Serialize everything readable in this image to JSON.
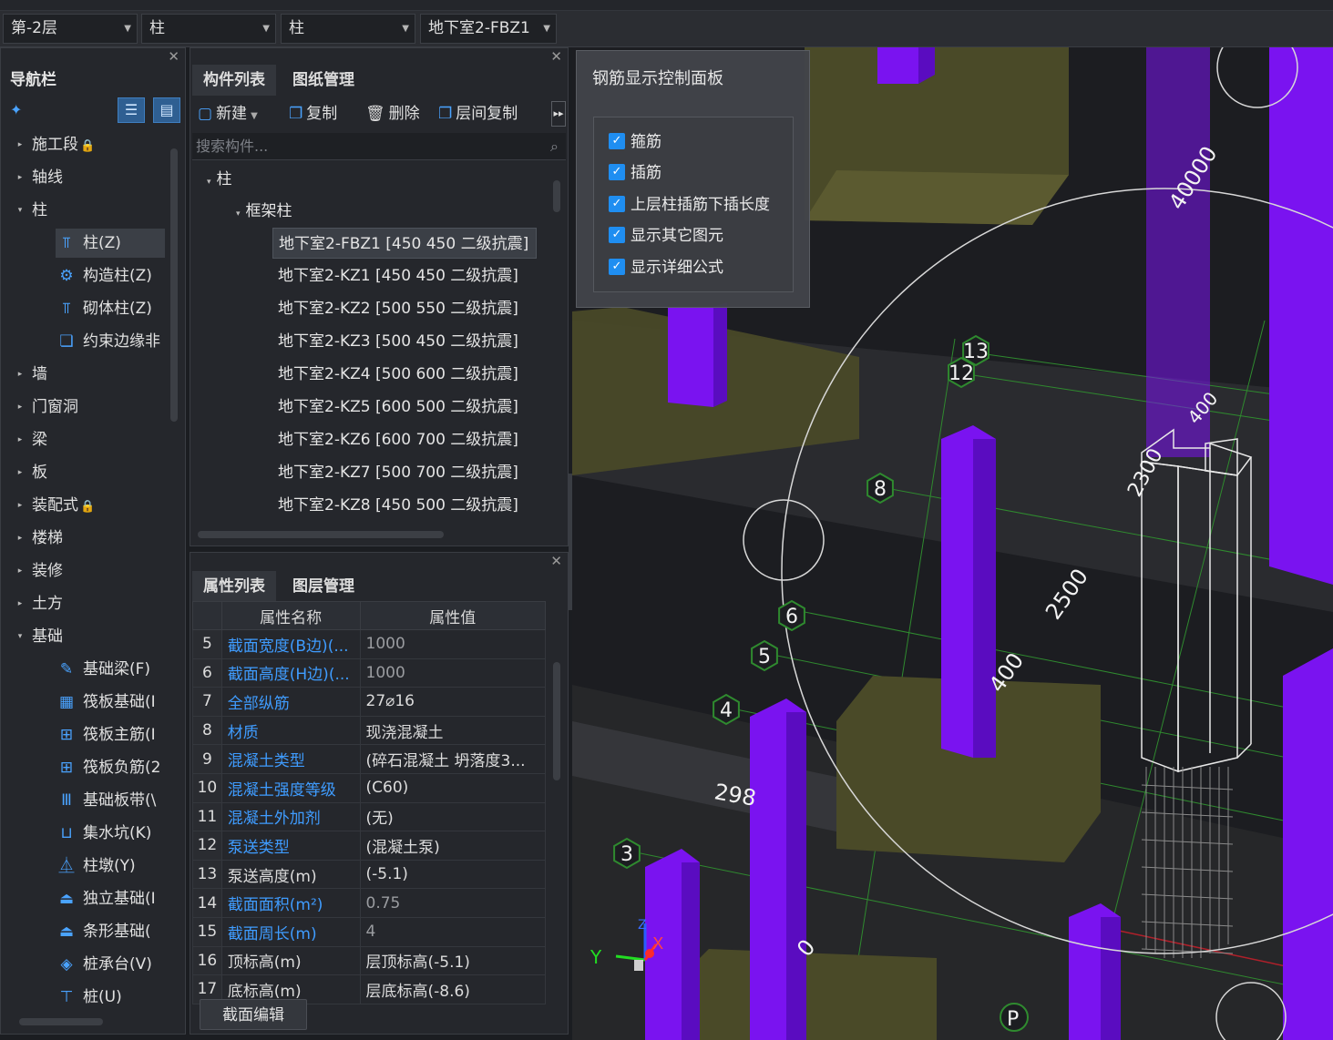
{
  "toolbar": {
    "floor": "第-2层",
    "category": "柱",
    "type": "柱",
    "component": "地下室2-FBZ1"
  },
  "nav": {
    "title": "导航栏",
    "items": [
      {
        "label": "施工段",
        "icon": "lock-icon",
        "level": 0,
        "expand": "▸"
      },
      {
        "label": "轴线",
        "level": 0,
        "expand": "▸"
      },
      {
        "label": "柱",
        "level": 0,
        "expand": "▾"
      },
      {
        "label": "柱(Z)",
        "icon": "column-icon",
        "level": 1,
        "selected": true
      },
      {
        "label": "构造柱(Z)",
        "icon": "construct-column-icon",
        "level": 1
      },
      {
        "label": "砌体柱(Z)",
        "icon": "masonry-column-icon",
        "level": 1
      },
      {
        "label": "约束边缘非",
        "icon": "constraint-edge-icon",
        "level": 1
      },
      {
        "label": "墙",
        "level": 0,
        "expand": "▸"
      },
      {
        "label": "门窗洞",
        "level": 0,
        "expand": "▸"
      },
      {
        "label": "梁",
        "level": 0,
        "expand": "▸"
      },
      {
        "label": "板",
        "level": 0,
        "expand": "▸"
      },
      {
        "label": "装配式",
        "icon": "lock-icon",
        "level": 0,
        "expand": "▸"
      },
      {
        "label": "楼梯",
        "level": 0,
        "expand": "▸"
      },
      {
        "label": "装修",
        "level": 0,
        "expand": "▸"
      },
      {
        "label": "土方",
        "level": 0,
        "expand": "▸"
      },
      {
        "label": "基础",
        "level": 0,
        "expand": "▾"
      },
      {
        "label": "基础梁(F)",
        "icon": "foundation-beam-icon",
        "level": 1
      },
      {
        "label": "筏板基础(I",
        "icon": "raft-foundation-icon",
        "level": 1
      },
      {
        "label": "筏板主筋(I",
        "icon": "raft-main-rebar-icon",
        "level": 1
      },
      {
        "label": "筏板负筋(2",
        "icon": "raft-neg-rebar-icon",
        "level": 1
      },
      {
        "label": "基础板带(\\",
        "icon": "foundation-strip-icon",
        "level": 1
      },
      {
        "label": "集水坑(K)",
        "icon": "sump-pit-icon",
        "level": 1
      },
      {
        "label": "柱墩(Y)",
        "icon": "column-pier-icon",
        "level": 1
      },
      {
        "label": "独立基础(I",
        "icon": "isolated-footing-icon",
        "level": 1
      },
      {
        "label": "条形基础(",
        "icon": "strip-footing-icon",
        "level": 1
      },
      {
        "label": "桩承台(V)",
        "icon": "pile-cap-icon",
        "level": 1
      },
      {
        "label": "桩(U)",
        "icon": "pile-icon",
        "level": 1
      }
    ]
  },
  "components": {
    "tabs": [
      "构件列表",
      "图纸管理"
    ],
    "actions": {
      "new": "新建",
      "copy": "复制",
      "delete": "删除",
      "floor_copy": "层间复制"
    },
    "search_placeholder": "搜索构件...",
    "root": "柱",
    "group": "框架柱",
    "list": [
      "地下室2-FBZ1 [450 450 二级抗震]",
      "地下室2-KZ1 [450 450 二级抗震]",
      "地下室2-KZ2 [500 550 二级抗震]",
      "地下室2-KZ3 [500 450 二级抗震]",
      "地下室2-KZ4 [500 600 二级抗震]",
      "地下室2-KZ5 [600 500 二级抗震]",
      "地下室2-KZ6 [600 700 二级抗震]",
      "地下室2-KZ7 [500 700 二级抗震]",
      "地下室2-KZ8 [450 500 二级抗震]"
    ]
  },
  "properties": {
    "tabs": [
      "属性列表",
      "图层管理"
    ],
    "headers": [
      "属性名称",
      "属性值"
    ],
    "rows": [
      {
        "idx": "5",
        "name": "截面宽度(B边)(...",
        "value": "1000",
        "blue": true,
        "dim": true
      },
      {
        "idx": "6",
        "name": "截面高度(H边)(...",
        "value": "1000",
        "blue": true,
        "dim": true
      },
      {
        "idx": "7",
        "name": "全部纵筋",
        "value": "27⌀16",
        "blue": true
      },
      {
        "idx": "8",
        "name": "材质",
        "value": "现浇混凝土",
        "blue": true
      },
      {
        "idx": "9",
        "name": "混凝土类型",
        "value": "(碎石混凝土 坍落度3...",
        "blue": true
      },
      {
        "idx": "10",
        "name": "混凝土强度等级",
        "value": "(C60)",
        "blue": true
      },
      {
        "idx": "11",
        "name": "混凝土外加剂",
        "value": "(无)",
        "blue": true
      },
      {
        "idx": "12",
        "name": "泵送类型",
        "value": "(混凝土泵)",
        "blue": true
      },
      {
        "idx": "13",
        "name": "泵送高度(m)",
        "value": "(-5.1)"
      },
      {
        "idx": "14",
        "name": "截面面积(m²)",
        "value": "0.75",
        "blue": true,
        "dim": true
      },
      {
        "idx": "15",
        "name": "截面周长(m)",
        "value": "4",
        "blue": true,
        "dim": true
      },
      {
        "idx": "16",
        "name": "顶标高(m)",
        "value": "层顶标高(-5.1)"
      },
      {
        "idx": "17",
        "name": "底标高(m)",
        "value": "层底标高(-8.6)"
      }
    ],
    "edit_button": "截面编辑"
  },
  "rebar_panel": {
    "title": "钢筋显示控制面板",
    "options": [
      "箍筋",
      "插筋",
      "上层柱插筋下插长度",
      "显示其它图元",
      "显示详细公式"
    ]
  },
  "viewport": {
    "axis_labels": [
      "13",
      "12",
      "8",
      "6",
      "5",
      "4",
      "3"
    ],
    "dimensions": [
      "40000",
      "400",
      "2300",
      "2500",
      "400",
      "298",
      "0"
    ],
    "axes": [
      "Y",
      "X",
      "Z"
    ],
    "marker": "P",
    "colors": {
      "column": "#7a13f0",
      "column_side": "#5a0cc0",
      "foundation": "#4a4a28",
      "grid": "#2f8a2f"
    }
  }
}
